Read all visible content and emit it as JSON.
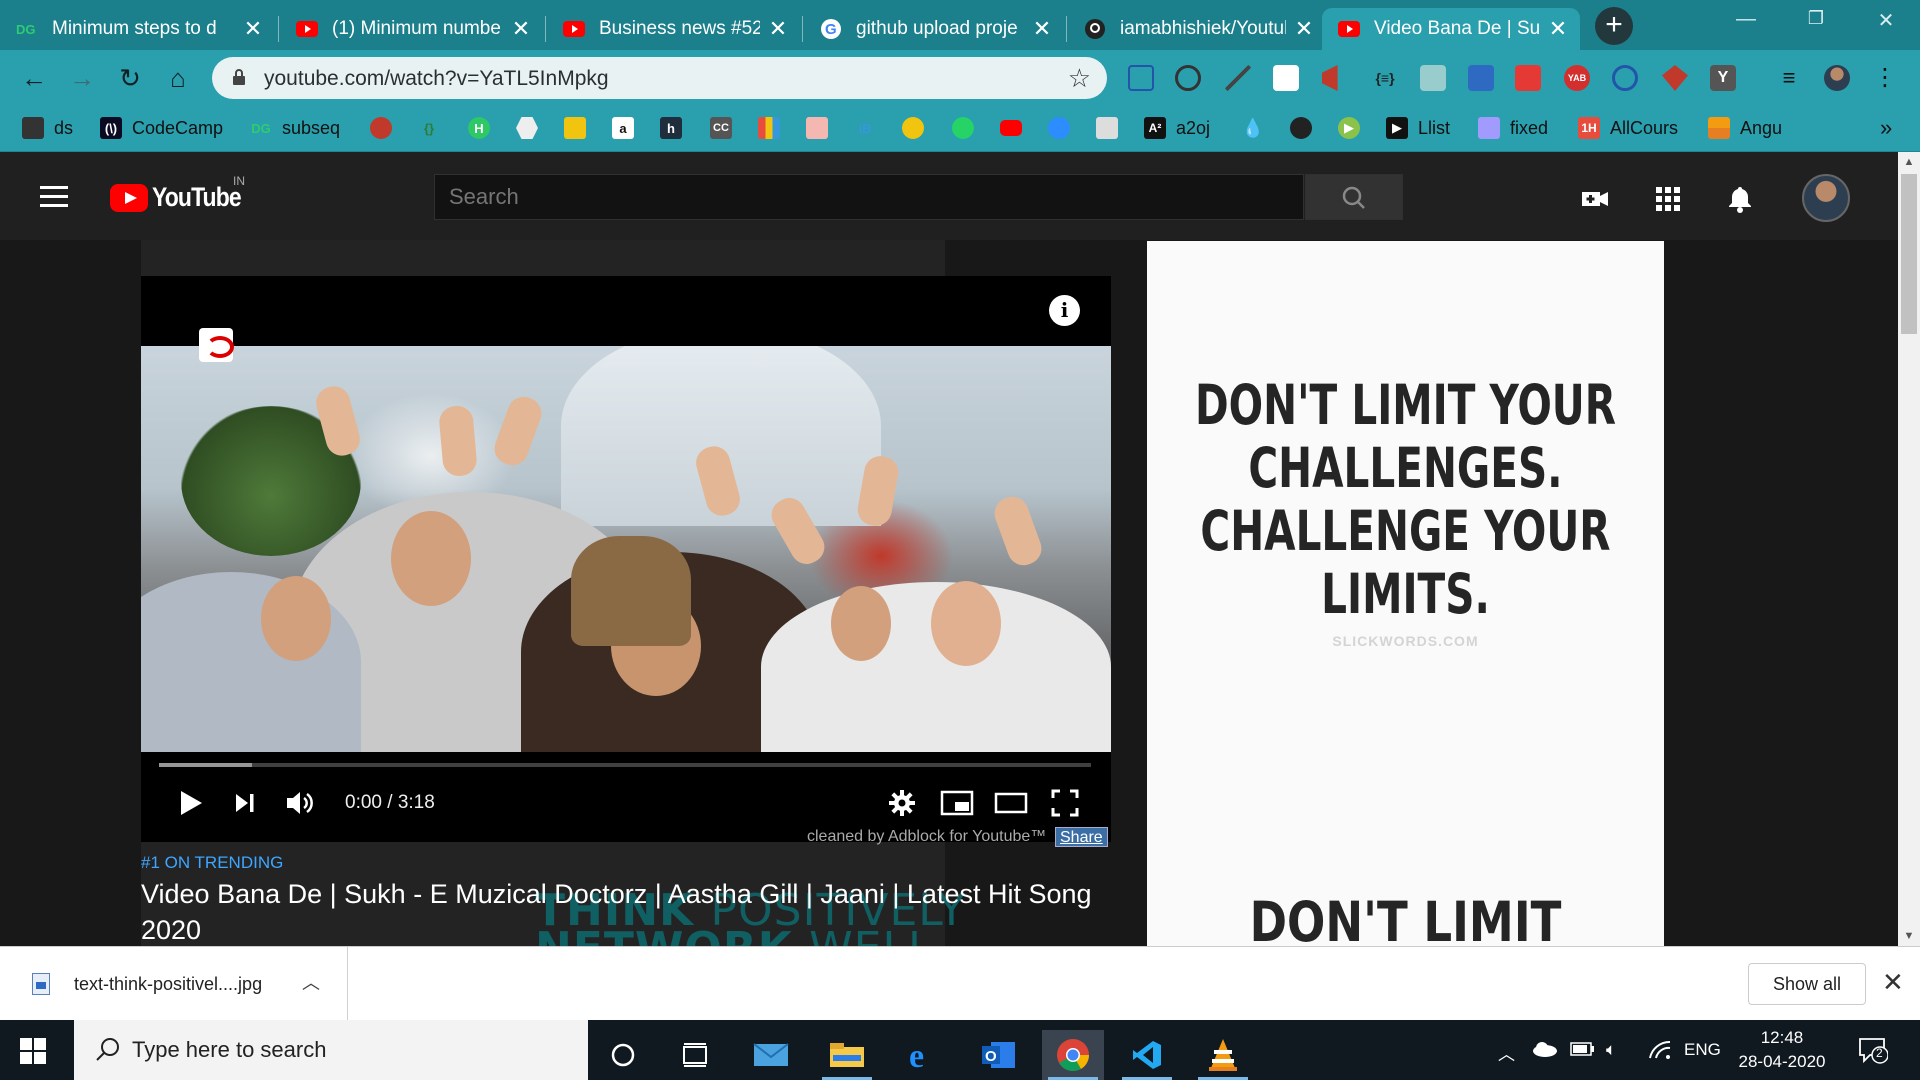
{
  "browser": {
    "tabs": [
      {
        "title": "Minimum steps to d",
        "favicon": "dg-icon",
        "active": false
      },
      {
        "title": "(1) Minimum numbe",
        "favicon": "youtube-icon",
        "active": false
      },
      {
        "title": "Business news #52 |",
        "favicon": "youtube-icon",
        "active": false
      },
      {
        "title": "github upload proje",
        "favicon": "google-icon",
        "active": false
      },
      {
        "title": "iamabhishiek/Youtul",
        "favicon": "github-icon",
        "active": false
      },
      {
        "title": "Video Bana De | Suk",
        "favicon": "youtube-icon",
        "active": true
      }
    ],
    "new_tab_label": "+",
    "url": "youtube.com/watch?v=YaTL5InMpkg",
    "bookmarks": [
      {
        "label": "ds",
        "icon": "ds-icon"
      },
      {
        "label": "CodeCamp",
        "icon": "freecodecamp-icon"
      },
      {
        "label": "subseq",
        "icon": "dg-icon"
      },
      {
        "label": "",
        "icon": "db-icon"
      },
      {
        "label": "",
        "icon": "braces-icon"
      },
      {
        "label": "",
        "icon": "hackerrank-icon"
      },
      {
        "label": "",
        "icon": "hexagon-icon"
      },
      {
        "label": "",
        "icon": "folder-icon"
      },
      {
        "label": "",
        "icon": "amazon-icon"
      },
      {
        "label": "",
        "icon": "h-icon"
      },
      {
        "label": "",
        "icon": "cc-icon"
      },
      {
        "label": "",
        "icon": "bars-icon"
      },
      {
        "label": "",
        "icon": "box-icon"
      },
      {
        "label": "",
        "icon": "ib-icon"
      },
      {
        "label": "",
        "icon": "bulb-icon"
      },
      {
        "label": "",
        "icon": "whatsapp-icon"
      },
      {
        "label": "",
        "icon": "youtube-icon"
      },
      {
        "label": "",
        "icon": "zoom-icon"
      },
      {
        "label": "",
        "icon": "bot-icon"
      },
      {
        "label": "a2oj",
        "icon": "a2-icon"
      },
      {
        "label": "",
        "icon": "drop-icon"
      },
      {
        "label": "",
        "icon": "github-icon"
      },
      {
        "label": "",
        "icon": "play-icon"
      },
      {
        "label": "Llist",
        "icon": "leetcode-icon"
      },
      {
        "label": "fixed",
        "icon": "photo-icon"
      },
      {
        "label": "AllCours",
        "icon": "1h-icon"
      },
      {
        "label": "Angu",
        "icon": "stack-icon"
      }
    ],
    "bookmarks_overflow": "»"
  },
  "youtube": {
    "logo_text": "YouTube",
    "country_code": "IN",
    "search_placeholder": "Search",
    "player": {
      "current_time": "0:00",
      "duration": "3:18",
      "time_display": "0:00 / 3:18",
      "progress": 0.0,
      "buffered": 0.1
    },
    "cleaned_by": "cleaned by Adblock for Youtube™",
    "share_label": "Share",
    "trending_label": "#1 ON TRENDING",
    "video_title": "Video Bana De | Sukh - E Muzical Doctorz | Aastha Gill | Jaani | Latest Hit Song 2020",
    "background_text": {
      "think": "THINK",
      "positively": "POSITIVELY",
      "network": "NETWORK",
      "well": "WELL"
    },
    "ad": {
      "quote": "DON'T LIMIT YOUR CHALLENGES. CHALLENGE YOUR LIMITS.",
      "quote_lines": [
        "DON'T LIMIT YOUR",
        "CHALLENGES.",
        "CHALLENGE YOUR",
        "LIMITS."
      ],
      "source": "SLICKWORDS.COM",
      "quote_repeat": "DON'T LIMIT YOUR"
    }
  },
  "download_shelf": {
    "file_name": "text-think-positivel....jpg",
    "show_all_label": "Show all"
  },
  "taskbar": {
    "search_placeholder": "Type here to search",
    "language": "ENG",
    "time": "12:48",
    "date": "28-04-2020",
    "notification_count": "2"
  },
  "colors": {
    "chrome_frame": "#1b7f8c",
    "chrome_toolbar": "#2a9fad",
    "youtube_red": "#ff0000",
    "trending_blue": "#3ea6ff",
    "youtube_dark": "#202020"
  }
}
